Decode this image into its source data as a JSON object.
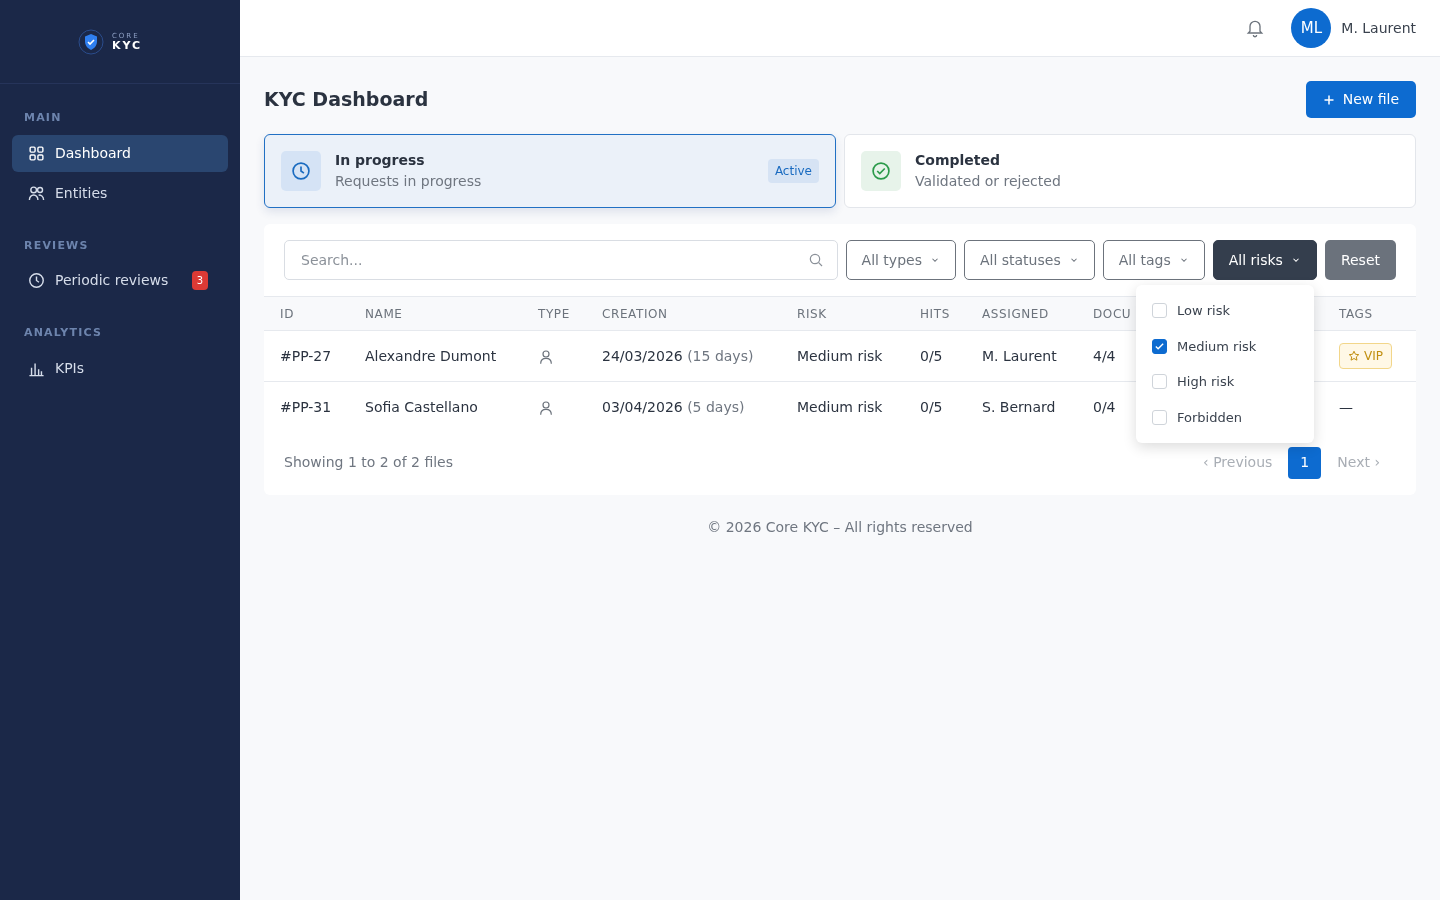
{
  "brand": {
    "small": "CORE",
    "name": "KYC"
  },
  "sidebar": {
    "sections": [
      {
        "title": "MAIN",
        "items": [
          {
            "label": "Dashboard",
            "kind": "grid",
            "selected": true
          },
          {
            "label": "Entities",
            "kind": "users",
            "selected": false
          }
        ]
      },
      {
        "title": "REVIEWS",
        "items": [
          {
            "label": "Periodic reviews",
            "kind": "clock",
            "selected": false,
            "badge": "3"
          }
        ]
      },
      {
        "title": "ANALYTICS",
        "items": [
          {
            "label": "KPIs",
            "kind": "chart",
            "selected": false
          }
        ]
      }
    ]
  },
  "topbar": {
    "avatar": "ML",
    "user": "M. Laurent"
  },
  "page": {
    "title": "KYC Dashboard",
    "new_button": "New file"
  },
  "status_cards": [
    {
      "title": "In progress",
      "subtitle": "Requests in progress",
      "kind": "clock",
      "selected": true,
      "badge": "Active"
    },
    {
      "title": "Completed",
      "subtitle": "Validated or rejected",
      "kind": "check",
      "selected": false
    }
  ],
  "filters": {
    "search_placeholder": "Search...",
    "dropdowns": [
      {
        "label": "All types",
        "open": false
      },
      {
        "label": "All statuses",
        "open": false
      },
      {
        "label": "All tags",
        "open": false
      },
      {
        "label": "All risks",
        "open": true
      }
    ],
    "reset": "Reset",
    "risk_options": [
      {
        "label": "Low risk",
        "checked": false
      },
      {
        "label": "Medium risk",
        "checked": true
      },
      {
        "label": "High risk",
        "checked": false
      },
      {
        "label": "Forbidden",
        "checked": false
      }
    ]
  },
  "table": {
    "columns": [
      "ID",
      "NAME",
      "TYPE",
      "CREATION",
      "RISK",
      "HITS",
      "ASSIGNED",
      "DOCU",
      "TAGS"
    ],
    "rows": [
      {
        "id": "#PP-27",
        "name": "Alexandre Dumont",
        "kind": "person",
        "date": "24/03/2026",
        "ago": "(15 days)",
        "risk": "Medium risk",
        "hits": "0/5",
        "assigned": "M. Laurent",
        "docs": "4/4",
        "tag": "VIP"
      },
      {
        "id": "#PP-31",
        "name": "Sofia Castellano",
        "kind": "person",
        "date": "03/04/2026",
        "ago": "(5 days)",
        "risk": "Medium risk",
        "hits": "0/5",
        "assigned": "S. Bernard",
        "docs": "0/4",
        "empty_tag": "—"
      }
    ]
  },
  "pagination": {
    "summary": "Showing 1 to 2 of 2 files",
    "previous": "‹ Previous",
    "pages": [
      {
        "label": "1",
        "selected": true
      }
    ],
    "next": "Next ›"
  },
  "footer": "© 2026 Core KYC – All rights reserved"
}
